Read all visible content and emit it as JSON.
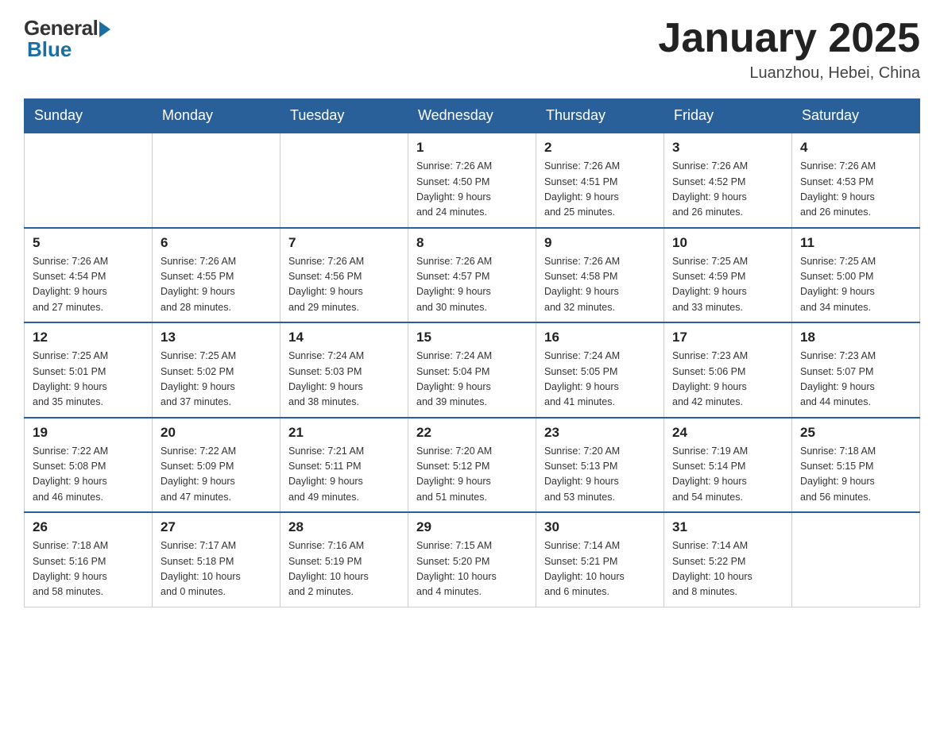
{
  "header": {
    "logo_general": "General",
    "logo_blue": "Blue",
    "month_title": "January 2025",
    "location": "Luanzhou, Hebei, China"
  },
  "weekdays": [
    "Sunday",
    "Monday",
    "Tuesday",
    "Wednesday",
    "Thursday",
    "Friday",
    "Saturday"
  ],
  "weeks": [
    [
      {
        "day": "",
        "info": ""
      },
      {
        "day": "",
        "info": ""
      },
      {
        "day": "",
        "info": ""
      },
      {
        "day": "1",
        "info": "Sunrise: 7:26 AM\nSunset: 4:50 PM\nDaylight: 9 hours\nand 24 minutes."
      },
      {
        "day": "2",
        "info": "Sunrise: 7:26 AM\nSunset: 4:51 PM\nDaylight: 9 hours\nand 25 minutes."
      },
      {
        "day": "3",
        "info": "Sunrise: 7:26 AM\nSunset: 4:52 PM\nDaylight: 9 hours\nand 26 minutes."
      },
      {
        "day": "4",
        "info": "Sunrise: 7:26 AM\nSunset: 4:53 PM\nDaylight: 9 hours\nand 26 minutes."
      }
    ],
    [
      {
        "day": "5",
        "info": "Sunrise: 7:26 AM\nSunset: 4:54 PM\nDaylight: 9 hours\nand 27 minutes."
      },
      {
        "day": "6",
        "info": "Sunrise: 7:26 AM\nSunset: 4:55 PM\nDaylight: 9 hours\nand 28 minutes."
      },
      {
        "day": "7",
        "info": "Sunrise: 7:26 AM\nSunset: 4:56 PM\nDaylight: 9 hours\nand 29 minutes."
      },
      {
        "day": "8",
        "info": "Sunrise: 7:26 AM\nSunset: 4:57 PM\nDaylight: 9 hours\nand 30 minutes."
      },
      {
        "day": "9",
        "info": "Sunrise: 7:26 AM\nSunset: 4:58 PM\nDaylight: 9 hours\nand 32 minutes."
      },
      {
        "day": "10",
        "info": "Sunrise: 7:25 AM\nSunset: 4:59 PM\nDaylight: 9 hours\nand 33 minutes."
      },
      {
        "day": "11",
        "info": "Sunrise: 7:25 AM\nSunset: 5:00 PM\nDaylight: 9 hours\nand 34 minutes."
      }
    ],
    [
      {
        "day": "12",
        "info": "Sunrise: 7:25 AM\nSunset: 5:01 PM\nDaylight: 9 hours\nand 35 minutes."
      },
      {
        "day": "13",
        "info": "Sunrise: 7:25 AM\nSunset: 5:02 PM\nDaylight: 9 hours\nand 37 minutes."
      },
      {
        "day": "14",
        "info": "Sunrise: 7:24 AM\nSunset: 5:03 PM\nDaylight: 9 hours\nand 38 minutes."
      },
      {
        "day": "15",
        "info": "Sunrise: 7:24 AM\nSunset: 5:04 PM\nDaylight: 9 hours\nand 39 minutes."
      },
      {
        "day": "16",
        "info": "Sunrise: 7:24 AM\nSunset: 5:05 PM\nDaylight: 9 hours\nand 41 minutes."
      },
      {
        "day": "17",
        "info": "Sunrise: 7:23 AM\nSunset: 5:06 PM\nDaylight: 9 hours\nand 42 minutes."
      },
      {
        "day": "18",
        "info": "Sunrise: 7:23 AM\nSunset: 5:07 PM\nDaylight: 9 hours\nand 44 minutes."
      }
    ],
    [
      {
        "day": "19",
        "info": "Sunrise: 7:22 AM\nSunset: 5:08 PM\nDaylight: 9 hours\nand 46 minutes."
      },
      {
        "day": "20",
        "info": "Sunrise: 7:22 AM\nSunset: 5:09 PM\nDaylight: 9 hours\nand 47 minutes."
      },
      {
        "day": "21",
        "info": "Sunrise: 7:21 AM\nSunset: 5:11 PM\nDaylight: 9 hours\nand 49 minutes."
      },
      {
        "day": "22",
        "info": "Sunrise: 7:20 AM\nSunset: 5:12 PM\nDaylight: 9 hours\nand 51 minutes."
      },
      {
        "day": "23",
        "info": "Sunrise: 7:20 AM\nSunset: 5:13 PM\nDaylight: 9 hours\nand 53 minutes."
      },
      {
        "day": "24",
        "info": "Sunrise: 7:19 AM\nSunset: 5:14 PM\nDaylight: 9 hours\nand 54 minutes."
      },
      {
        "day": "25",
        "info": "Sunrise: 7:18 AM\nSunset: 5:15 PM\nDaylight: 9 hours\nand 56 minutes."
      }
    ],
    [
      {
        "day": "26",
        "info": "Sunrise: 7:18 AM\nSunset: 5:16 PM\nDaylight: 9 hours\nand 58 minutes."
      },
      {
        "day": "27",
        "info": "Sunrise: 7:17 AM\nSunset: 5:18 PM\nDaylight: 10 hours\nand 0 minutes."
      },
      {
        "day": "28",
        "info": "Sunrise: 7:16 AM\nSunset: 5:19 PM\nDaylight: 10 hours\nand 2 minutes."
      },
      {
        "day": "29",
        "info": "Sunrise: 7:15 AM\nSunset: 5:20 PM\nDaylight: 10 hours\nand 4 minutes."
      },
      {
        "day": "30",
        "info": "Sunrise: 7:14 AM\nSunset: 5:21 PM\nDaylight: 10 hours\nand 6 minutes."
      },
      {
        "day": "31",
        "info": "Sunrise: 7:14 AM\nSunset: 5:22 PM\nDaylight: 10 hours\nand 8 minutes."
      },
      {
        "day": "",
        "info": ""
      }
    ]
  ]
}
